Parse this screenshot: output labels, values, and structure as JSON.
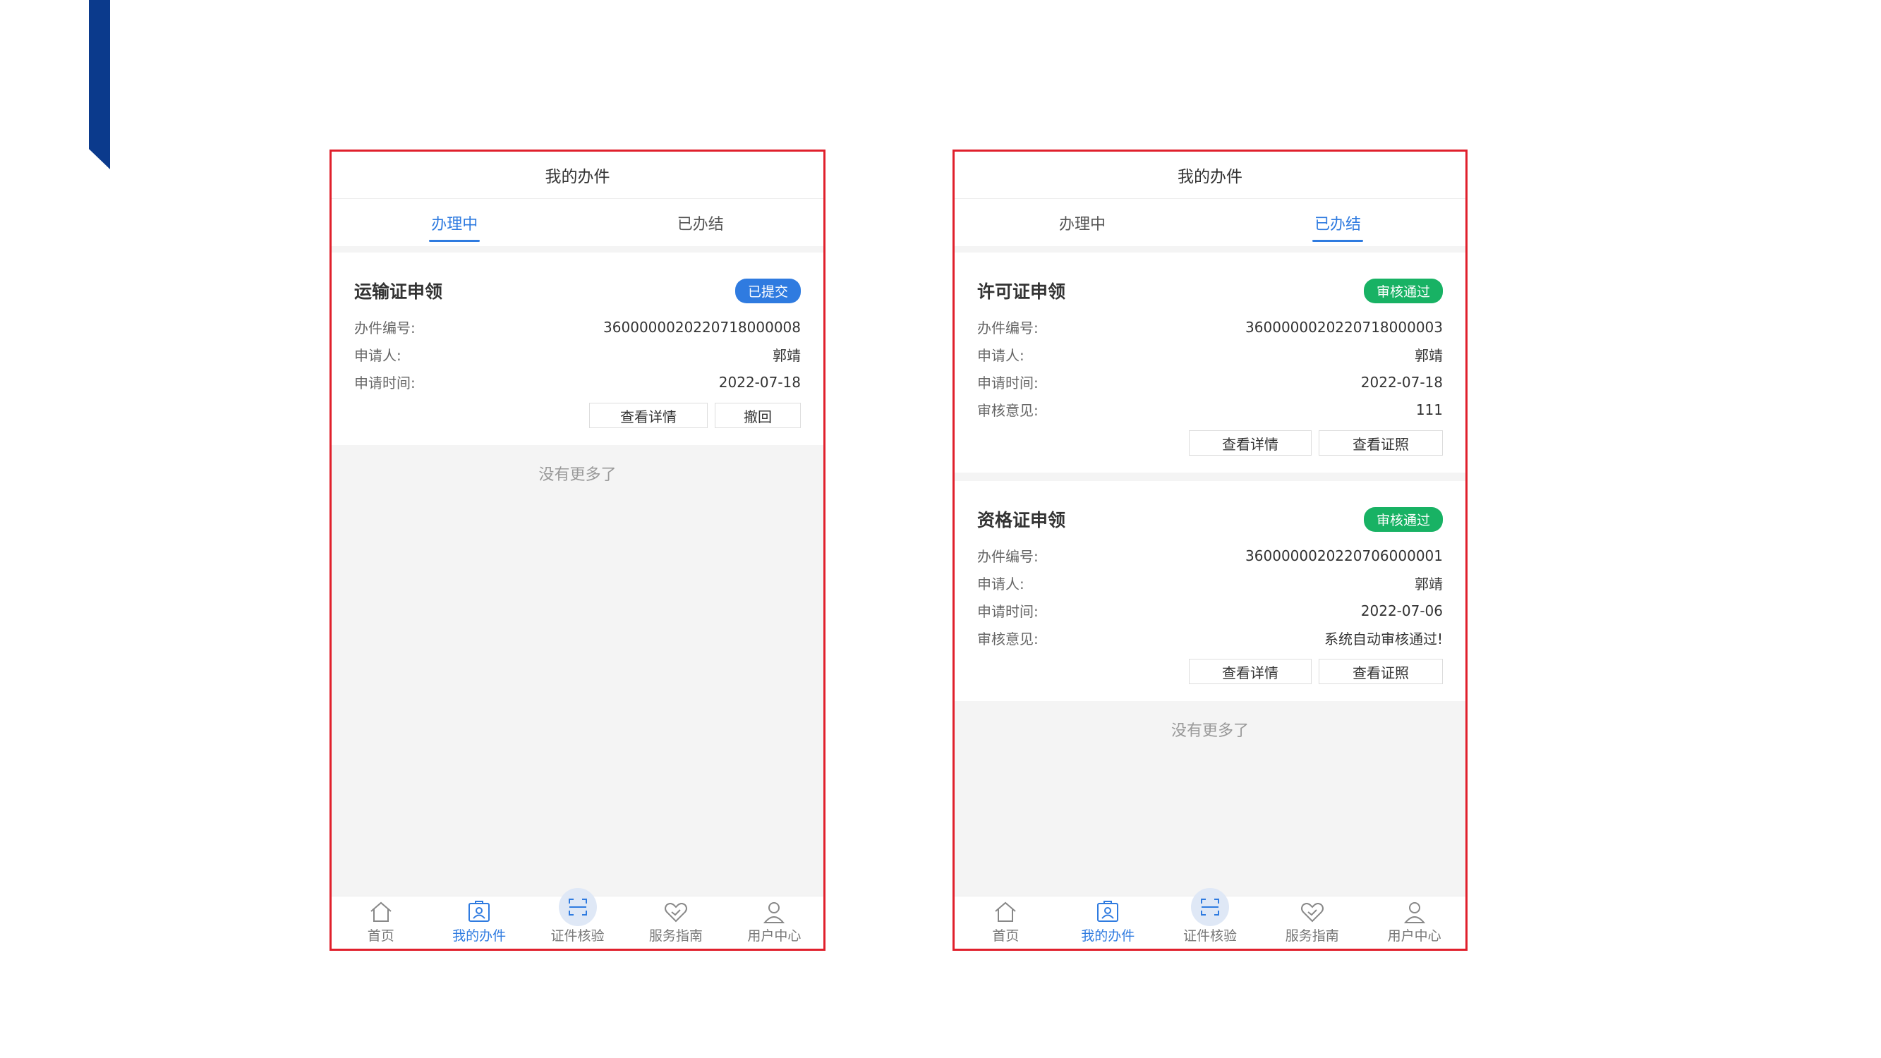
{
  "colors": {
    "accent_bar": "#0b3a8c",
    "frame": "#e0202c",
    "primary": "#2f7be0",
    "success": "#18b264"
  },
  "phone1": {
    "title": "我的办件",
    "tabs": [
      {
        "label": "办理中",
        "active": true
      },
      {
        "label": "已办结",
        "active": false
      }
    ],
    "cards": [
      {
        "title": "运输证申领",
        "badge": "已提交",
        "rows": [
          {
            "key": "办件编号:",
            "value": "3600000020220718000008"
          },
          {
            "key": "申请人:",
            "value": "郭靖"
          },
          {
            "key": "申请时间:",
            "value": "2022-07-18"
          }
        ],
        "buttons": [
          "查看详情",
          "撤回"
        ]
      }
    ],
    "no_more": "没有更多了",
    "tabbar": [
      {
        "label": "首页",
        "icon": "home-icon"
      },
      {
        "label": "我的办件",
        "icon": "id-card-icon",
        "active": true
      },
      {
        "label": "证件核验",
        "icon": "scan-icon"
      },
      {
        "label": "服务指南",
        "icon": "handshake-heart-icon"
      },
      {
        "label": "用户中心",
        "icon": "user-icon"
      }
    ]
  },
  "phone2": {
    "title": "我的办件",
    "tabs": [
      {
        "label": "办理中",
        "active": false
      },
      {
        "label": "已办结",
        "active": true
      }
    ],
    "cards": [
      {
        "title": "许可证申领",
        "badge": "审核通过",
        "rows": [
          {
            "key": "办件编号:",
            "value": "3600000020220718000003"
          },
          {
            "key": "申请人:",
            "value": "郭靖"
          },
          {
            "key": "申请时间:",
            "value": "2022-07-18"
          },
          {
            "key": "审核意见:",
            "value": "111"
          }
        ],
        "buttons": [
          "查看详情",
          "查看证照"
        ]
      },
      {
        "title": "资格证申领",
        "badge": "审核通过",
        "rows": [
          {
            "key": "办件编号:",
            "value": "3600000020220706000001"
          },
          {
            "key": "申请人:",
            "value": "郭靖"
          },
          {
            "key": "申请时间:",
            "value": "2022-07-06"
          },
          {
            "key": "审核意见:",
            "value": "系统自动审核通过!"
          }
        ],
        "buttons": [
          "查看详情",
          "查看证照"
        ]
      }
    ],
    "no_more": "没有更多了",
    "tabbar": [
      {
        "label": "首页",
        "icon": "home-icon"
      },
      {
        "label": "我的办件",
        "icon": "id-card-icon",
        "active": true
      },
      {
        "label": "证件核验",
        "icon": "scan-icon"
      },
      {
        "label": "服务指南",
        "icon": "handshake-heart-icon"
      },
      {
        "label": "用户中心",
        "icon": "user-icon"
      }
    ]
  }
}
